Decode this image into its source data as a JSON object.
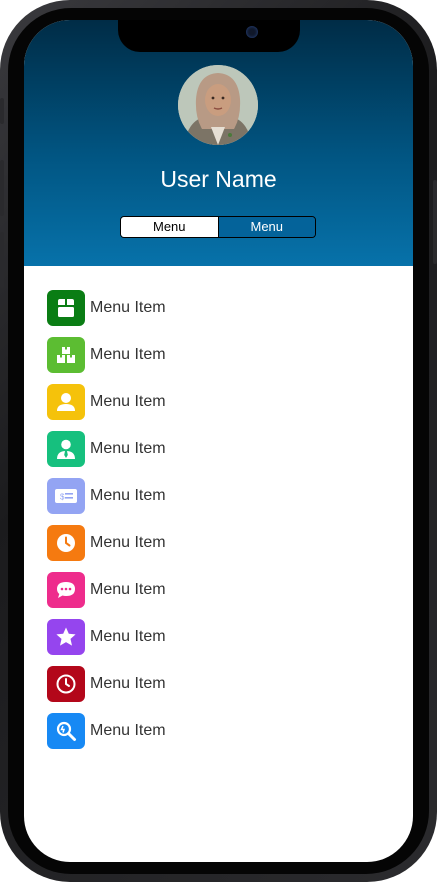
{
  "profile": {
    "name": "User Name"
  },
  "segmented": {
    "options": [
      "Menu",
      "Menu"
    ],
    "selected_index": 0
  },
  "menu": {
    "items": [
      {
        "label": "Menu Item",
        "icon": "package-icon",
        "color": "#0a7d14"
      },
      {
        "label": "Menu Item",
        "icon": "boxes-icon",
        "color": "#5cbd32"
      },
      {
        "label": "Menu Item",
        "icon": "user-icon",
        "color": "#f5c20b"
      },
      {
        "label": "Menu Item",
        "icon": "user-tie-icon",
        "color": "#16c07e"
      },
      {
        "label": "Menu Item",
        "icon": "money-check-icon",
        "color": "#93a4f3"
      },
      {
        "label": "Menu Item",
        "icon": "clock-icon",
        "color": "#f57a10"
      },
      {
        "label": "Menu Item",
        "icon": "chat-bubble-icon",
        "color": "#ee2c8c"
      },
      {
        "label": "Menu Item",
        "icon": "star-icon",
        "color": "#9545ee"
      },
      {
        "label": "Menu Item",
        "icon": "clock-outline-icon",
        "color": "#b3071a"
      },
      {
        "label": "Menu Item",
        "icon": "search-tool-icon",
        "color": "#1789f4"
      }
    ]
  }
}
